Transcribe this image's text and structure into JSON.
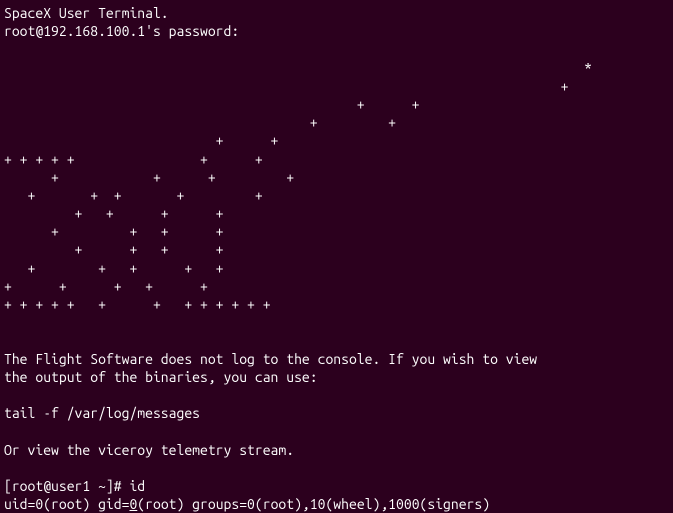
{
  "banner": {
    "line1": "SpaceX User Terminal.",
    "line2": "root@192.168.100.1's password:"
  },
  "ascii_art": "                                                                          *\n                                                                       +\n                                             +      +\n                                       +         +\n                           +      +\n+ + + + +                +      +\n      +            +      +         +\n   +       +  +       +         +\n         +   +      +      +\n      +         +   +      +\n         +      +   +      +\n   +        +   +      +   +\n+      +      +   +      +\n+ + + + +   +      +   + + + + + +",
  "message": {
    "line1": "The Flight Software does not log to the console. If you wish to view",
    "line2": "the output of the binaries, you can use:",
    "line3": "tail -f /var/log/messages",
    "line4": "Or view the viceroy telemetry stream."
  },
  "prompt": {
    "prefix": "[root@user1 ~]# ",
    "command": "id",
    "output_pre": "uid=0(root) gid=",
    "output_underline": "0",
    "output_post": "(root) groups=0(root),10(wheel),1000(signers)"
  }
}
